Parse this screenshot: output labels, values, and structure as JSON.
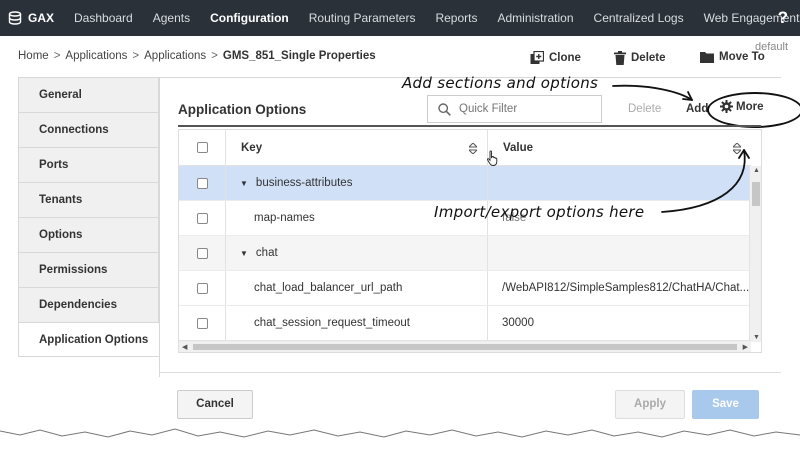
{
  "navbar": {
    "brand": "GAX",
    "items": [
      {
        "label": "Dashboard",
        "active": false
      },
      {
        "label": "Agents",
        "active": false
      },
      {
        "label": "Configuration",
        "active": true
      },
      {
        "label": "Routing Parameters",
        "active": false
      },
      {
        "label": "Reports",
        "active": false
      },
      {
        "label": "Administration",
        "active": false
      },
      {
        "label": "Centralized Logs",
        "active": false
      },
      {
        "label": "Web Engagement",
        "active": false
      }
    ],
    "help": "?"
  },
  "breadcrumb": [
    "Home",
    "Applications",
    "Applications",
    "GMS_851_Single Properties"
  ],
  "breadcrumb_separator": ">",
  "default_tag": "default",
  "toolbar": {
    "clone": "Clone",
    "delete": "Delete",
    "move_to": "Move To"
  },
  "sidebar": {
    "items": [
      {
        "label": "General"
      },
      {
        "label": "Connections"
      },
      {
        "label": "Ports"
      },
      {
        "label": "Tenants"
      },
      {
        "label": "Options"
      },
      {
        "label": "Permissions"
      },
      {
        "label": "Dependencies"
      },
      {
        "label": "Application Options",
        "active": true
      }
    ]
  },
  "panel": {
    "title": "Application Options",
    "filter_placeholder": "Quick Filter",
    "delete_label": "Delete",
    "add_label": "Add",
    "more_label": "More"
  },
  "table": {
    "columns": [
      "Key",
      "Value"
    ],
    "rows": [
      {
        "key": "business-attributes",
        "value": "",
        "section": true,
        "selected": true
      },
      {
        "key": "map-names",
        "value": "false",
        "section": false
      },
      {
        "key": "chat",
        "value": "",
        "section": true
      },
      {
        "key": "chat_load_balancer_url_path",
        "value": "/WebAPI812/SimpleSamples812/ChatHA/Chat...",
        "section": false
      },
      {
        "key": "chat_session_request_timeout",
        "value": "30000",
        "section": false
      }
    ]
  },
  "footer": {
    "cancel": "Cancel",
    "apply": "Apply",
    "save": "Save"
  },
  "annotations": {
    "add_sections": "Add sections and options",
    "import_export": "Import/export options here"
  },
  "colors": {
    "navbar_bg": "#2b3138",
    "selected_row": "#cfe0f7",
    "save_button": "#a9c9ec"
  }
}
